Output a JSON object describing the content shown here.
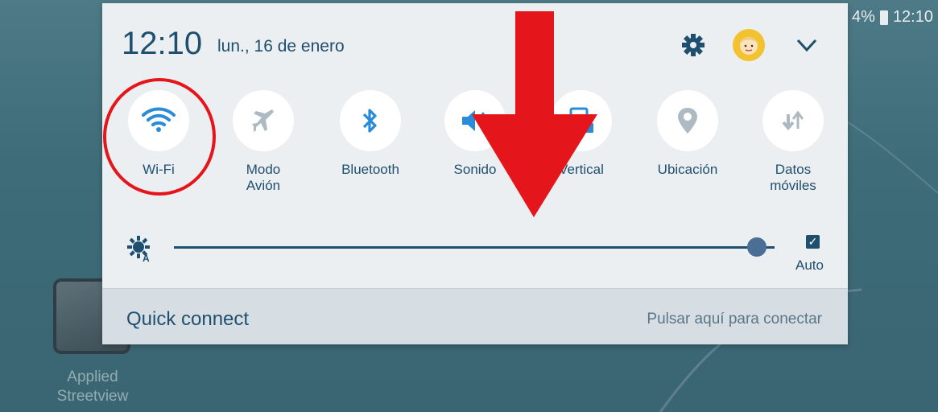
{
  "status_bar": {
    "battery": "4%",
    "time": "12:10"
  },
  "panel": {
    "clock": "12:10",
    "date": "lun., 16 de enero"
  },
  "quick_toggles": [
    {
      "label": "Wi-Fi",
      "icon": "wifi-icon"
    },
    {
      "label": "Modo\nAvión",
      "icon": "airplane-icon"
    },
    {
      "label": "Bluetooth",
      "icon": "bluetooth-icon"
    },
    {
      "label": "Sonido",
      "icon": "sound-icon"
    },
    {
      "label": "Vertical",
      "icon": "rotation-lock-icon"
    },
    {
      "label": "Ubicación",
      "icon": "location-icon"
    },
    {
      "label": "Datos\nmóviles",
      "icon": "mobile-data-icon"
    }
  ],
  "brightness": {
    "level": 0.97,
    "auto_label": "Auto",
    "auto_checked": true
  },
  "quick_connect": {
    "title": "Quick connect",
    "hint": "Pulsar aquí para conectar"
  },
  "desktop_app": {
    "label": "Applied\nStreetview"
  },
  "colors": {
    "accent": "#1f4f6e",
    "annotation": "#e4161b"
  }
}
